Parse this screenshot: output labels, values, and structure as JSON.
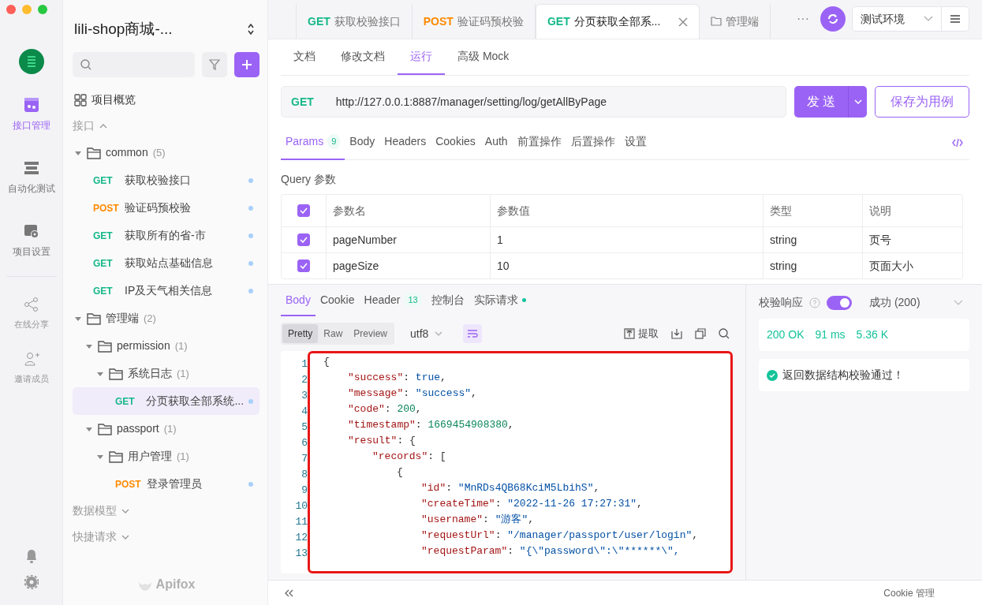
{
  "rail": {
    "items": [
      {
        "label": "接口管理",
        "selected": true
      },
      {
        "label": "自动化测试",
        "selected": false
      },
      {
        "label": "项目设置",
        "selected": false
      }
    ],
    "extras": [
      {
        "label": "在线分享"
      },
      {
        "label": "邀请成员"
      }
    ]
  },
  "sidebar": {
    "project": "lili-shop商城-...",
    "overview": "项目概览",
    "brand": "Apifox",
    "sections": [
      {
        "label": "接口",
        "expanded": true,
        "children": [
          {
            "kind": "folder",
            "label": "common",
            "count": "(5)",
            "expanded": true,
            "children": [
              {
                "kind": "endpoint",
                "method": "GET",
                "label": "获取校验接口",
                "selected": false
              },
              {
                "kind": "endpoint",
                "method": "POST",
                "label": "验证码预校验",
                "selected": false
              },
              {
                "kind": "endpoint",
                "method": "GET",
                "label": "获取所有的省-市",
                "selected": false
              },
              {
                "kind": "endpoint",
                "method": "GET",
                "label": "获取站点基础信息",
                "selected": false
              },
              {
                "kind": "endpoint",
                "method": "GET",
                "label": "IP及天气相关信息",
                "selected": false
              }
            ]
          },
          {
            "kind": "folder",
            "label": "管理端",
            "count": "(2)",
            "expanded": true,
            "children": [
              {
                "kind": "folder",
                "label": "permission",
                "count": "(1)",
                "expanded": true,
                "children": [
                  {
                    "kind": "folder",
                    "label": "系统日志",
                    "count": "(1)",
                    "expanded": true,
                    "children": [
                      {
                        "kind": "endpoint",
                        "method": "GET",
                        "label": "分页获取全部系统...",
                        "selected": true
                      }
                    ]
                  }
                ]
              },
              {
                "kind": "folder",
                "label": "passport",
                "count": "(1)",
                "expanded": true,
                "children": [
                  {
                    "kind": "folder",
                    "label": "用户管理",
                    "count": "(1)",
                    "expanded": true,
                    "children": [
                      {
                        "kind": "endpoint",
                        "method": "POST",
                        "label": "登录管理员",
                        "selected": false
                      }
                    ]
                  }
                ]
              }
            ]
          }
        ]
      },
      {
        "label": "数据模型",
        "expanded": false
      },
      {
        "label": "快捷请求",
        "expanded": false
      }
    ]
  },
  "tabs": [
    {
      "kind": "endpoint",
      "method": "GET",
      "label": "获取校验接口",
      "selected": false
    },
    {
      "kind": "endpoint",
      "method": "POST",
      "label": "验证码预校验",
      "selected": false
    },
    {
      "kind": "endpoint",
      "method": "GET",
      "label": "分页获取全部系...",
      "selected": true
    },
    {
      "kind": "folder",
      "label": "管理端",
      "selected": false
    }
  ],
  "more": "···",
  "environment": "测试环境",
  "view_tabs": [
    {
      "label": "文档",
      "selected": false
    },
    {
      "label": "修改文档",
      "selected": false
    },
    {
      "label": "运行",
      "selected": true
    },
    {
      "label": "高级 Mock",
      "selected": false
    }
  ],
  "request": {
    "method": "GET",
    "url": "http://127.0.0.1:8887/manager/setting/log/getAllByPage",
    "send": "发 送",
    "save": "保存为用例"
  },
  "param_tabs": [
    {
      "label": "Params",
      "badge": "9",
      "selected": true
    },
    {
      "label": "Body",
      "selected": false
    },
    {
      "label": "Headers",
      "selected": false
    },
    {
      "label": "Cookies",
      "selected": false
    },
    {
      "label": "Auth",
      "selected": false
    },
    {
      "label": "前置操作",
      "selected": false
    },
    {
      "label": "后置操作",
      "selected": false
    },
    {
      "label": "设置",
      "selected": false
    }
  ],
  "query": {
    "title": "Query 参数",
    "all_checked": true,
    "columns": [
      "参数名",
      "参数值",
      "类型",
      "说明"
    ],
    "rows": [
      {
        "checked": true,
        "cells": [
          "pageNumber",
          "1",
          "string",
          "页号"
        ]
      },
      {
        "checked": true,
        "cells": [
          "pageSize",
          "10",
          "string",
          "页面大小"
        ]
      }
    ]
  },
  "response_tabs": [
    {
      "label": "Body",
      "selected": true
    },
    {
      "label": "Cookie",
      "selected": false
    },
    {
      "label": "Header",
      "badge": "13",
      "selected": false
    },
    {
      "label": "控制台",
      "selected": false
    },
    {
      "label": "实际请求",
      "dot": true,
      "selected": false
    }
  ],
  "formats": [
    {
      "label": "Pretty",
      "selected": true
    },
    {
      "label": "Raw",
      "selected": false
    },
    {
      "label": "Preview",
      "selected": false
    }
  ],
  "encoding": "utf8",
  "wrap_on": true,
  "extract": "提取",
  "code": [
    {
      "number": "1",
      "tokens": [
        {
          "kind": "punct",
          "text": "{"
        }
      ]
    },
    {
      "number": "2",
      "tokens": [
        {
          "kind": "key",
          "text": "\"success\""
        },
        {
          "kind": "punct",
          "text": ": "
        },
        {
          "kind": "bool",
          "text": "true"
        },
        {
          "kind": "punct",
          "text": ","
        }
      ]
    },
    {
      "number": "3",
      "tokens": [
        {
          "kind": "key",
          "text": "\"message\""
        },
        {
          "kind": "punct",
          "text": ": "
        },
        {
          "kind": "string",
          "text": "\"success\""
        },
        {
          "kind": "punct",
          "text": ","
        }
      ]
    },
    {
      "number": "4",
      "tokens": [
        {
          "kind": "key",
          "text": "\"code\""
        },
        {
          "kind": "punct",
          "text": ": "
        },
        {
          "kind": "number",
          "text": "200"
        },
        {
          "kind": "punct",
          "text": ","
        }
      ]
    },
    {
      "number": "5",
      "tokens": [
        {
          "kind": "key",
          "text": "\"timestamp\""
        },
        {
          "kind": "punct",
          "text": ": "
        },
        {
          "kind": "number",
          "text": "1669454908380"
        },
        {
          "kind": "punct",
          "text": ","
        }
      ]
    },
    {
      "number": "6",
      "tokens": [
        {
          "kind": "key",
          "text": "\"result\""
        },
        {
          "kind": "punct",
          "text": ": {"
        }
      ]
    },
    {
      "number": "7",
      "tokens": [
        {
          "kind": "key",
          "text": "\"records\""
        },
        {
          "kind": "punct",
          "text": ": ["
        }
      ]
    },
    {
      "number": "8",
      "tokens": [
        {
          "kind": "punct",
          "text": "{"
        }
      ]
    },
    {
      "number": "9",
      "tokens": [
        {
          "kind": "key",
          "text": "\"id\""
        },
        {
          "kind": "punct",
          "text": ": "
        },
        {
          "kind": "string",
          "text": "\"MnRDs4QB68KciM5LbihS\""
        },
        {
          "kind": "punct",
          "text": ","
        }
      ]
    },
    {
      "number": "10",
      "tokens": [
        {
          "kind": "key",
          "text": "\"createTime\""
        },
        {
          "kind": "punct",
          "text": ": "
        },
        {
          "kind": "string",
          "text": "\"2022-11-26 17:27:31\""
        },
        {
          "kind": "punct",
          "text": ","
        }
      ]
    },
    {
      "number": "11",
      "tokens": [
        {
          "kind": "key",
          "text": "\"username\""
        },
        {
          "kind": "punct",
          "text": ": "
        },
        {
          "kind": "string",
          "text": "\"游客\""
        },
        {
          "kind": "punct",
          "text": ","
        }
      ]
    },
    {
      "number": "12",
      "tokens": [
        {
          "kind": "key",
          "text": "\"requestUrl\""
        },
        {
          "kind": "punct",
          "text": ": "
        },
        {
          "kind": "string",
          "text": "\"/manager/passport/user/login\""
        },
        {
          "kind": "punct",
          "text": ","
        }
      ]
    },
    {
      "number": "13",
      "tokens": [
        {
          "kind": "key",
          "text": "\"requestParam\""
        },
        {
          "kind": "punct",
          "text": ": "
        },
        {
          "kind": "string",
          "text": "\"{\\\"password\\\":\\\"******\\\","
        }
      ]
    }
  ],
  "validation": {
    "label": "校验响应",
    "on": true,
    "result": "成功 (200)",
    "stats": [
      "200 OK",
      "91 ms",
      "5.36 K"
    ],
    "message": "返回数据结构校验通过！"
  },
  "status_bar": {
    "cookie": "Cookie 管理"
  }
}
